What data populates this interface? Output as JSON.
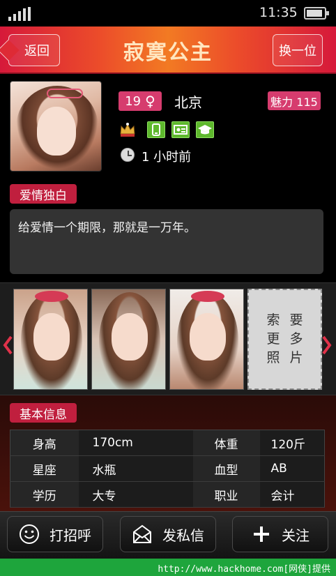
{
  "status_bar": {
    "time": "11:35"
  },
  "header": {
    "back_label": "返回",
    "title": "寂寞公主",
    "switch_label": "换一位"
  },
  "profile": {
    "age": "19",
    "gender_symbol": "♀",
    "city": "北京",
    "charm": "魅力 115",
    "badges": [
      "crown-icon",
      "phone-icon",
      "id-card-icon",
      "graduation-cap-icon"
    ],
    "last_active": "1 小时前"
  },
  "monologue": {
    "heading": "爱情独白",
    "text": "给爱情一个期限，那就是一万年。"
  },
  "photos": {
    "more_photos_card": [
      "索",
      "要",
      "更",
      "多",
      "照",
      "片"
    ]
  },
  "basic_info": {
    "heading": "基本信息",
    "rows": [
      {
        "label1": "身高",
        "value1": "170cm",
        "label2": "体重",
        "value2": "120斤"
      },
      {
        "label1": "星座",
        "value1": "水瓶",
        "label2": "血型",
        "value2": "AB"
      },
      {
        "label1": "学历",
        "value1": "大专",
        "label2": "职业",
        "value2": "会计"
      }
    ]
  },
  "actions": {
    "greet": "打招呼",
    "message": "发私信",
    "follow": "关注"
  },
  "footer": {
    "text": "http://www.hackhome.com[网侠]提供"
  },
  "colors": {
    "accent": "#d63c6e",
    "tag_red": "#c01f3e",
    "title_gradient_center": "#f27a23",
    "footer_green": "#1ea53c",
    "badge_green": "#5eb82d"
  }
}
